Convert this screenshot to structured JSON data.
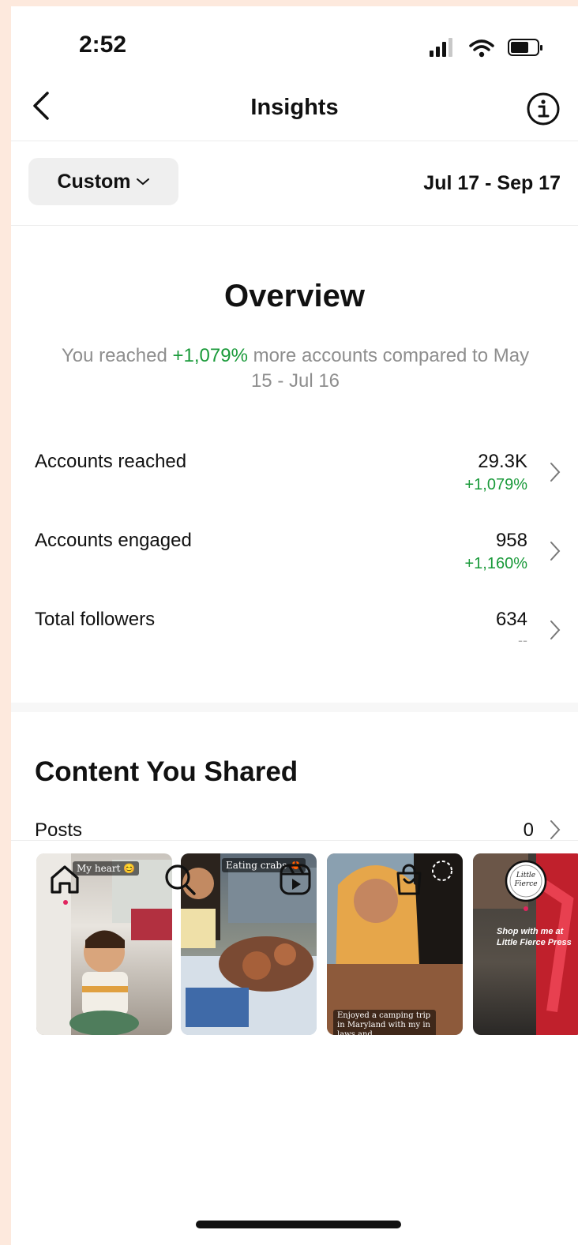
{
  "status_bar": {
    "time": "2:52"
  },
  "header": {
    "title": "Insights"
  },
  "filter": {
    "label": "Custom",
    "date_range": "Jul 17 - Sep 17"
  },
  "overview": {
    "title": "Overview",
    "desc_prefix": "You reached ",
    "desc_highlight": "+1,079%",
    "desc_suffix": " more accounts compared to May 15 - Jul 16"
  },
  "metrics": [
    {
      "label": "Accounts reached",
      "value": "29.3K",
      "change": "+1,079%"
    },
    {
      "label": "Accounts engaged",
      "value": "958",
      "change": "+1,160%"
    },
    {
      "label": "Total followers",
      "value": "634",
      "change": "--"
    }
  ],
  "content": {
    "title": "Content You Shared",
    "thumbnails": [
      {
        "caption": "My heart 😊"
      },
      {
        "caption": "Eating crabs 🦀"
      },
      {
        "caption": "Enjoyed a camping trip in Maryland with my in laws and"
      },
      {
        "caption": "Shop with me at Little Fierce Press"
      }
    ],
    "posts_label": "Posts",
    "posts_value": "0"
  },
  "nav": {
    "items": [
      {
        "icon": "home-icon"
      },
      {
        "icon": "search-icon"
      },
      {
        "icon": "reels-icon"
      },
      {
        "icon": "shop-icon"
      },
      {
        "icon": "profile-avatar"
      }
    ],
    "avatar_text": "Little Fierce"
  },
  "colors": {
    "accent_green": "#1a9a3a",
    "notification_dot": "#e0245e"
  }
}
